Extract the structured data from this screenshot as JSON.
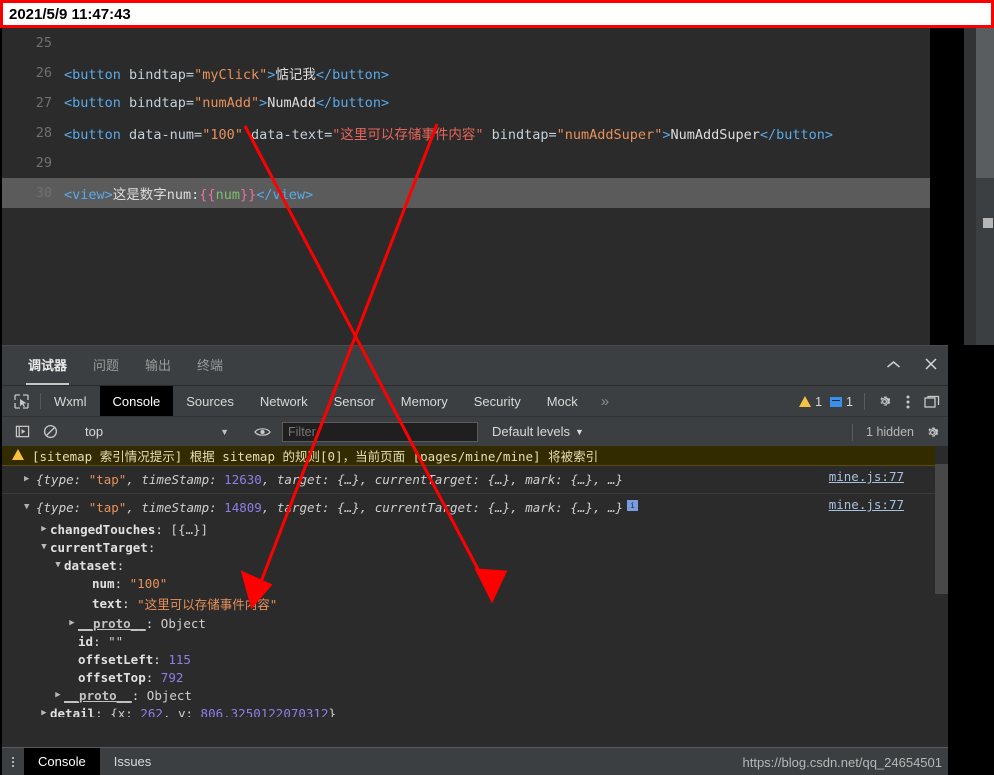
{
  "timestamp": "2021/5/9 11:47:43",
  "editor": {
    "lines": [
      {
        "no": "25",
        "segments": []
      },
      {
        "no": "26",
        "segments": [
          {
            "cls": "tg",
            "t": "<button "
          },
          {
            "cls": "at",
            "t": "bindtap="
          },
          {
            "cls": "st",
            "t": "\"myClick\""
          },
          {
            "cls": "tg",
            "t": ">"
          },
          {
            "cls": "tx",
            "t": "惦记我"
          },
          {
            "cls": "tg",
            "t": "</button>"
          }
        ]
      },
      {
        "no": "27",
        "segments": [
          {
            "cls": "tg",
            "t": "<button "
          },
          {
            "cls": "at",
            "t": "bindtap="
          },
          {
            "cls": "st",
            "t": "\"numAdd\""
          },
          {
            "cls": "tg",
            "t": ">"
          },
          {
            "cls": "tx",
            "t": "NumAdd"
          },
          {
            "cls": "tg",
            "t": "</button>"
          }
        ]
      },
      {
        "no": "28",
        "segments": [
          {
            "cls": "tg",
            "t": "<button "
          },
          {
            "cls": "at",
            "t": "data-num="
          },
          {
            "cls": "st",
            "t": "\"100\""
          },
          {
            "cls": "at",
            "t": " data-text="
          },
          {
            "cls": "stz",
            "t": "\"这里可以存储事件内容\""
          },
          {
            "cls": "at",
            "t": " bindtap="
          },
          {
            "cls": "st",
            "t": "\"numAddSuper\""
          },
          {
            "cls": "tg",
            "t": ">"
          },
          {
            "cls": "tx",
            "t": "NumAddSuper"
          },
          {
            "cls": "tg",
            "t": "</button>"
          }
        ]
      },
      {
        "no": "29",
        "segments": []
      },
      {
        "no": "30",
        "highlight": true,
        "segments": [
          {
            "cls": "tg",
            "t": "<view>"
          },
          {
            "cls": "tx",
            "t": "这是数字num:"
          },
          {
            "cls": "mst",
            "t": "{{"
          },
          {
            "cls": "mus",
            "t": "num"
          },
          {
            "cls": "mst",
            "t": "}}"
          },
          {
            "cls": "tg",
            "t": "</view>"
          }
        ]
      }
    ]
  },
  "dock": {
    "tabs": [
      {
        "label": "调试器",
        "active": true
      },
      {
        "label": "问题",
        "active": false
      },
      {
        "label": "输出",
        "active": false
      },
      {
        "label": "终端",
        "active": false
      }
    ],
    "collapse_icon": "chevron-up-icon",
    "close_icon": "close-icon"
  },
  "devtools": {
    "tabs": [
      {
        "label": "Wxml",
        "active": false
      },
      {
        "label": "Console",
        "active": true
      },
      {
        "label": "Sources",
        "active": false
      },
      {
        "label": "Network",
        "active": false
      },
      {
        "label": "Sensor",
        "active": false
      },
      {
        "label": "Memory",
        "active": false
      },
      {
        "label": "Security",
        "active": false
      },
      {
        "label": "Mock",
        "active": false
      }
    ],
    "more_label": "»",
    "warning_count": "1",
    "message_count": "1",
    "gear_icon": "gear-icon",
    "kebab_icon": "more-vertical-icon",
    "dock_icon": "dock-panel-icon",
    "inspect_icon": "inspect-element-icon"
  },
  "console_toolbar": {
    "execute_icon": "play-step-icon",
    "clear_icon": "clear-console-icon",
    "context": "top",
    "eye_icon": "live-expression-icon",
    "filter_value": "",
    "filter_placeholder": "Filter",
    "levels_label": "Default levels",
    "hidden_label": "1 hidden",
    "settings_icon": "gear-icon"
  },
  "console": {
    "warning": {
      "icon": "warning-triangle-icon",
      "text": "[sitemap 索引情况提示] 根据 sitemap 的规则[0]，当前页面 [pages/mine/mine] 将被索引"
    },
    "entries": [
      {
        "expanded": false,
        "preview_pre": "{type: ",
        "preview_type": "\"tap\"",
        "preview_mid": ", timeStamp: ",
        "timestamp": "12630",
        "preview_post": ", target: {…}, currentTarget: {…}, mark: {…}, …}",
        "source": "mine.js:77",
        "badge": ""
      },
      {
        "expanded": true,
        "preview_pre": "{type: ",
        "preview_type": "\"tap\"",
        "preview_mid": ", timeStamp: ",
        "timestamp": "14809",
        "preview_post": ", target: {…}, currentTarget: {…}, mark: {…}, …}",
        "source": "mine.js:77",
        "badge": "i"
      }
    ],
    "tree": [
      {
        "indent": 1,
        "tri": "▶",
        "name": "changedTouches",
        "sep": ": ",
        "value": "[{…}]",
        "vcls": "key"
      },
      {
        "indent": 1,
        "tri": "▼",
        "name": "currentTarget",
        "sep": ":",
        "value": "",
        "vcls": "key"
      },
      {
        "indent": 2,
        "tri": "▼",
        "name": "dataset",
        "sep": ":",
        "value": "",
        "vcls": "key"
      },
      {
        "indent": 4,
        "tri": "",
        "name": "num",
        "sep": ": ",
        "value": "\"100\"",
        "vcls": "strv"
      },
      {
        "indent": 4,
        "tri": "",
        "name": "text",
        "sep": ": ",
        "value": "\"这里可以存储事件内容\"",
        "vcls": "strv"
      },
      {
        "indent": 3,
        "tri": "▶",
        "name": "__proto__",
        "sep": ": ",
        "value": "Object",
        "vcls": "key",
        "proto": true
      },
      {
        "indent": 3,
        "tri": "",
        "name": "id",
        "sep": ": ",
        "value": "\"\"",
        "vcls": "key"
      },
      {
        "indent": 3,
        "tri": "",
        "name": "offsetLeft",
        "sep": ": ",
        "value": "115",
        "vcls": "numv"
      },
      {
        "indent": 3,
        "tri": "",
        "name": "offsetTop",
        "sep": ": ",
        "value": "792",
        "vcls": "numv"
      },
      {
        "indent": 2,
        "tri": "▶",
        "name": "__proto__",
        "sep": ": ",
        "value": "Object",
        "vcls": "key",
        "proto": true
      },
      {
        "indent": 1,
        "tri": "▶",
        "name": "detail",
        "sep": ": ",
        "value": "{x: 262, y: 806.3250122070312}",
        "vcls": "key",
        "mixed": true
      }
    ],
    "detail_parts": {
      "open": "{x: ",
      "x": "262",
      "mid": ", y: ",
      "y": "806.3250122070312",
      "close": "}"
    }
  },
  "drawer": {
    "tabs": [
      {
        "label": "Console",
        "active": true
      },
      {
        "label": "Issues",
        "active": false
      }
    ],
    "watermark": "https://blog.csdn.net/qq_24654501"
  },
  "colors": {
    "accent_red": "#fc0000",
    "warn_yellow": "#f5c242",
    "info_blue": "#3b8eea",
    "string_orange": "#e8915b",
    "number_purple": "#8f7fe8",
    "editor_bg": "#2b2b2b",
    "panel_bg": "#3c3f41"
  }
}
